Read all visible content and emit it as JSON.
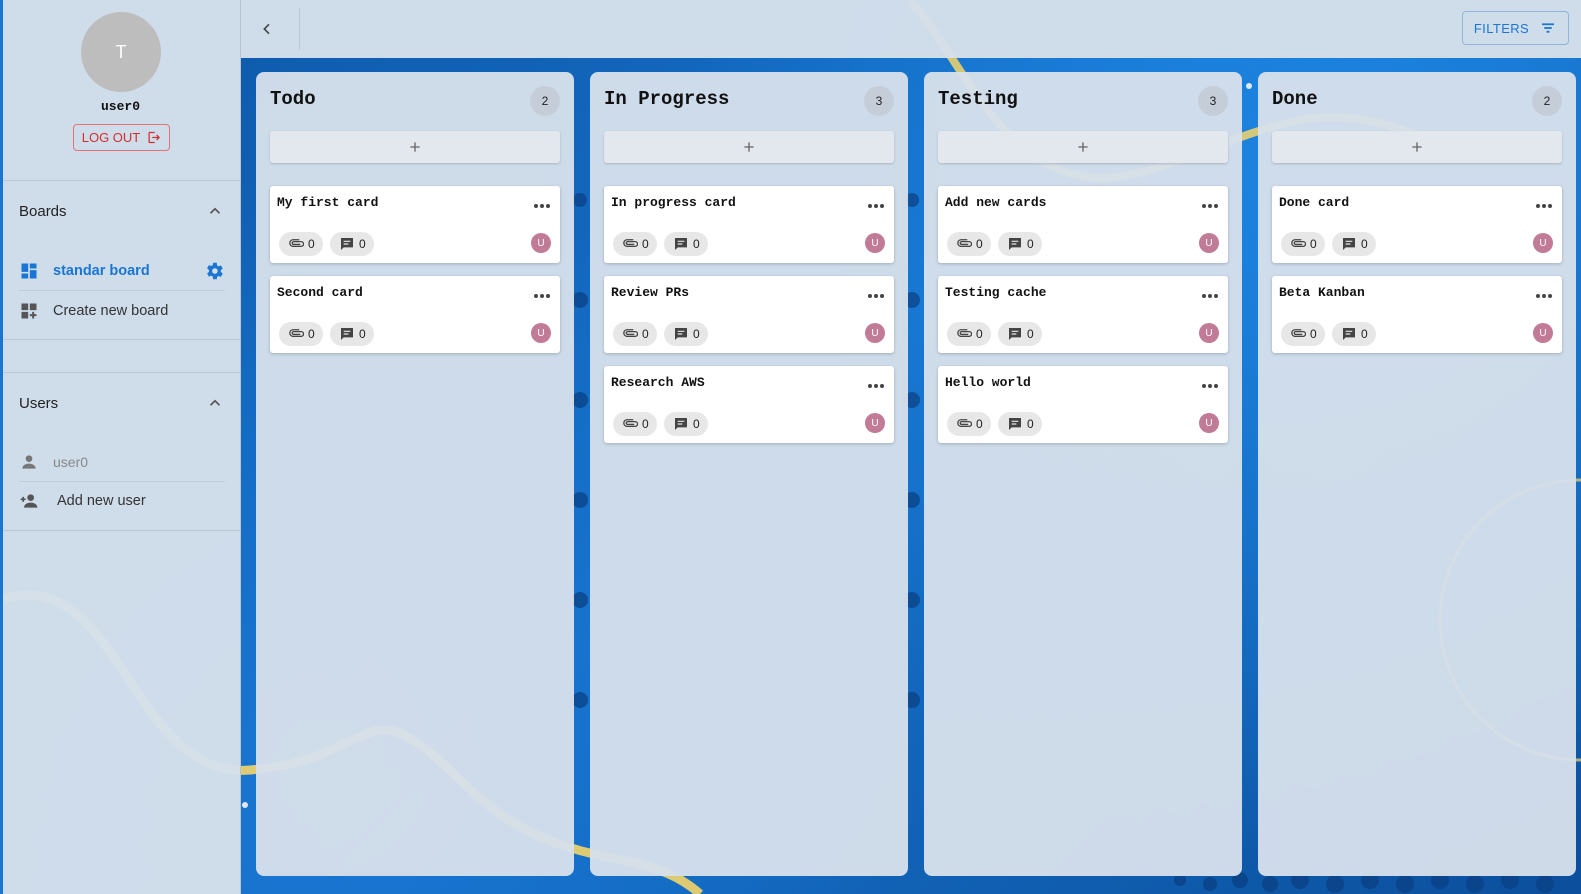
{
  "sidebar": {
    "avatar_initial": "T",
    "username": "user0",
    "logout_label": "LOG OUT",
    "boards": {
      "title": "Boards",
      "items": [
        {
          "label": "standar board",
          "active": true
        },
        {
          "label": "Create new board"
        }
      ]
    },
    "users": {
      "title": "Users",
      "items": [
        {
          "label": "user0"
        },
        {
          "label": "Add new user"
        }
      ]
    }
  },
  "topbar": {
    "filters_label": "FILTERS"
  },
  "columns": [
    {
      "title": "Todo",
      "count": "2",
      "cards": [
        {
          "title": "My first card",
          "attachments": "0",
          "comments": "0",
          "avatar": "U"
        },
        {
          "title": "Second card",
          "attachments": "0",
          "comments": "0",
          "avatar": "U"
        }
      ]
    },
    {
      "title": "In Progress",
      "count": "3",
      "cards": [
        {
          "title": "In progress card",
          "attachments": "0",
          "comments": "0",
          "avatar": "U"
        },
        {
          "title": "Review PRs",
          "attachments": "0",
          "comments": "0",
          "avatar": "U"
        },
        {
          "title": "Research AWS",
          "attachments": "0",
          "comments": "0",
          "avatar": "U"
        }
      ]
    },
    {
      "title": "Testing",
      "count": "3",
      "cards": [
        {
          "title": "Add new cards",
          "attachments": "0",
          "comments": "0",
          "avatar": "U"
        },
        {
          "title": "Testing cache",
          "attachments": "0",
          "comments": "0",
          "avatar": "U"
        },
        {
          "title": "Hello world",
          "attachments": "0",
          "comments": "0",
          "avatar": "U"
        }
      ]
    },
    {
      "title": "Done",
      "count": "2",
      "cards": [
        {
          "title": "Done card",
          "attachments": "0",
          "comments": "0",
          "avatar": "U"
        },
        {
          "title": "Beta Kanban",
          "attachments": "0",
          "comments": "0",
          "avatar": "U"
        }
      ]
    }
  ],
  "colors": {
    "accent": "#1976d2",
    "logout": "#d32f2f",
    "card_avatar": "#c27b97",
    "background": "#1160b4"
  },
  "icons": {
    "collapse": "chevron-left-icon",
    "filters": "filter-list-icon",
    "add_card": "plus-icon",
    "card_menu": "more-horizontal-icon",
    "attachment": "paperclip-icon",
    "comment": "comment-icon",
    "board": "dashboard-icon",
    "board_settings": "gear-icon",
    "new_board": "dashboard-add-icon",
    "user": "person-icon",
    "add_user": "person-add-icon",
    "logout": "logout-icon"
  }
}
